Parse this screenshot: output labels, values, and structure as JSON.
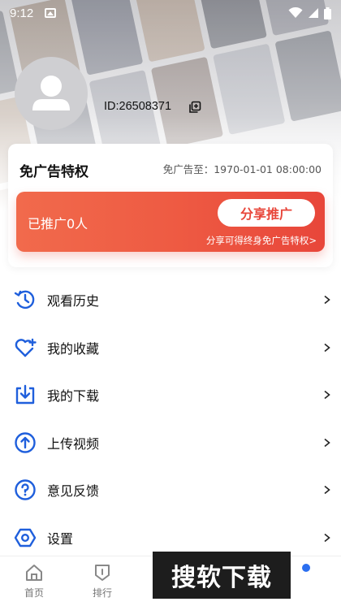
{
  "status_bar": {
    "time": "9:12"
  },
  "profile": {
    "user_id": "ID:26508371"
  },
  "vip": {
    "title": "免广告特权",
    "expiry": "免广告至：1970-01-01 08:00:00",
    "promo_count": "已推广0人",
    "share_button": "分享推广",
    "share_hint": "分享可得终身免广告特权>"
  },
  "menu": {
    "items": [
      {
        "label": "观看历史",
        "icon": "history-icon"
      },
      {
        "label": "我的收藏",
        "icon": "heart-plus-icon"
      },
      {
        "label": "我的下载",
        "icon": "download-icon"
      },
      {
        "label": "上传视频",
        "icon": "upload-icon"
      },
      {
        "label": "意见反馈",
        "icon": "help-icon"
      },
      {
        "label": "设置",
        "icon": "settings-icon"
      }
    ]
  },
  "bottom_nav": {
    "items": [
      {
        "label": "首页",
        "icon": "home-icon"
      },
      {
        "label": "排行",
        "icon": "rank-icon"
      }
    ]
  },
  "watermark": "搜软下载",
  "colors": {
    "accent_blue": "#1f5fdc",
    "promo_red": "#ea4c3d",
    "text_dark": "#111111"
  }
}
